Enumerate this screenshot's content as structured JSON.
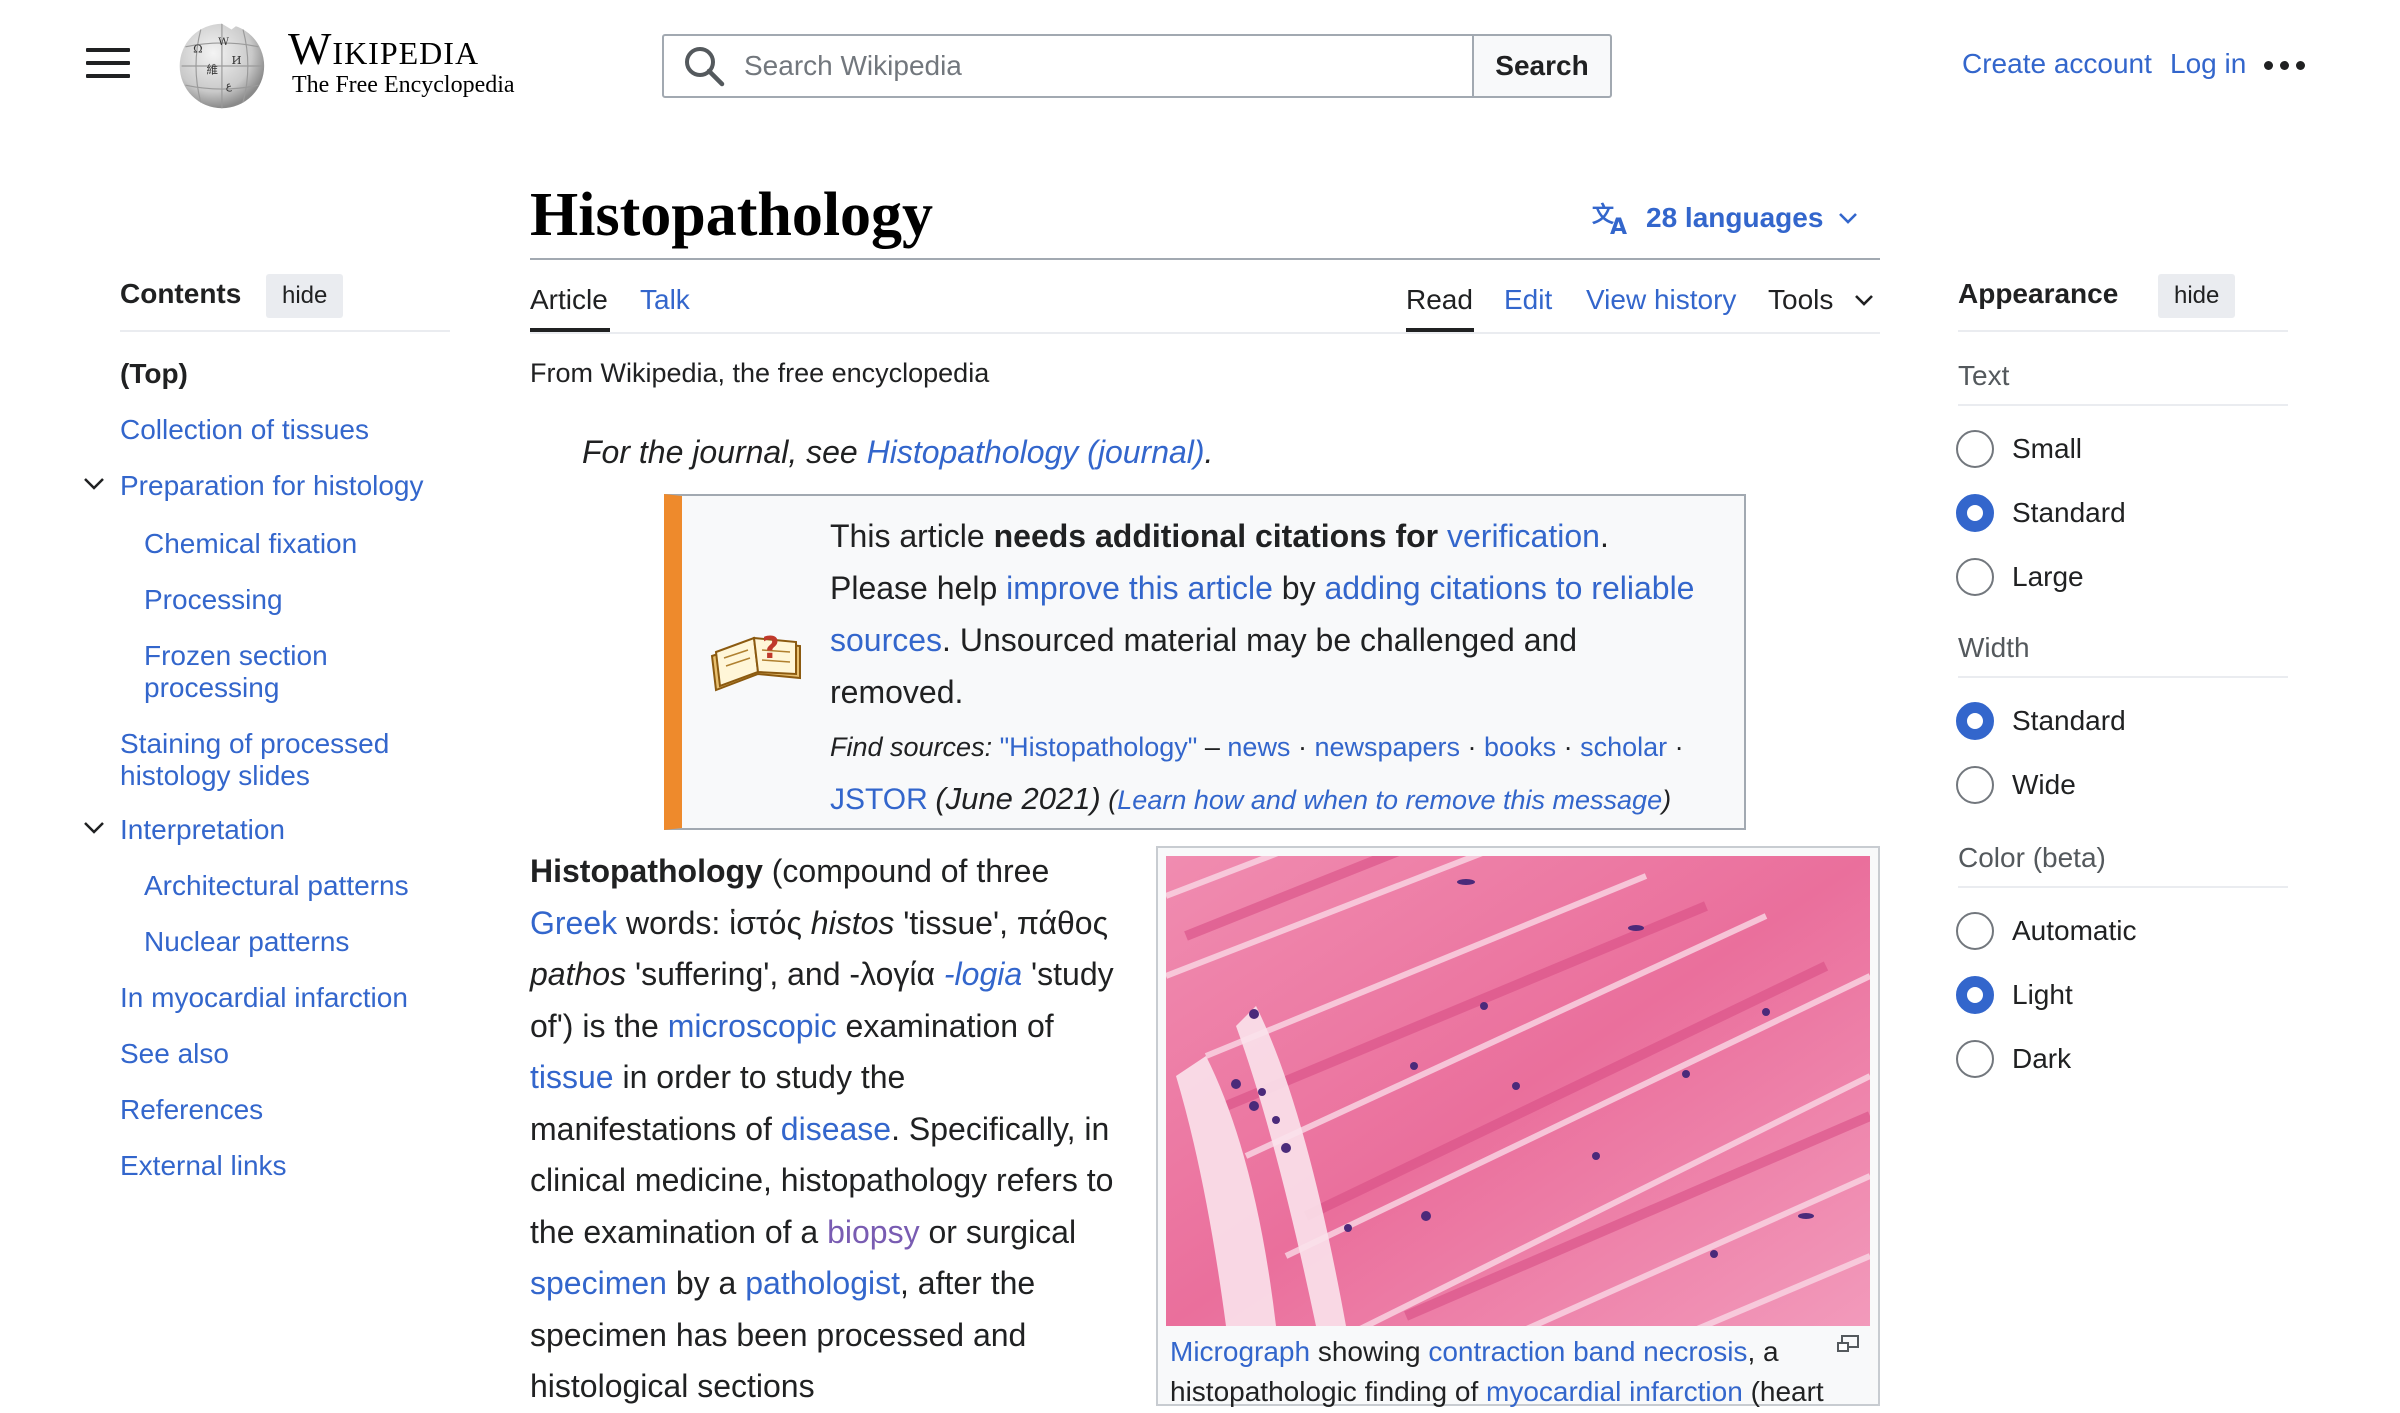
{
  "header": {
    "wordmark": "Wikipedia",
    "tagline": "The Free Encyclopedia",
    "search_placeholder": "Search Wikipedia",
    "search_button": "Search",
    "create_account": "Create account",
    "log_in": "Log in"
  },
  "toc": {
    "title": "Contents",
    "hide": "hide",
    "items": [
      {
        "label": "(Top)"
      },
      {
        "label": "Collection of tissues"
      },
      {
        "label": "Preparation for histology"
      },
      {
        "label": "Chemical fixation"
      },
      {
        "label": "Processing"
      },
      {
        "label": "Frozen section processing"
      },
      {
        "label": "Staining of processed histology slides"
      },
      {
        "label": "Interpretation"
      },
      {
        "label": "Architectural patterns"
      },
      {
        "label": "Nuclear patterns"
      },
      {
        "label": "In myocardial infarction"
      },
      {
        "label": "See also"
      },
      {
        "label": "References"
      },
      {
        "label": "External links"
      }
    ]
  },
  "article": {
    "title": "Histopathology",
    "languages": "28 languages",
    "tabs": {
      "article": "Article",
      "talk": "Talk",
      "read": "Read",
      "edit": "Edit",
      "view_history": "View history",
      "tools": "Tools"
    },
    "from": "From Wikipedia, the free encyclopedia",
    "hatnote_prefix": "For the journal, see",
    "hatnote_link": "Histopathology (journal)",
    "ambox": {
      "t1": "This article",
      "t1_bold": "needs additional citations for",
      "t1_link": "verification",
      "t2": "Please help",
      "t2_link1": "improve this article",
      "t2_mid": "by",
      "t2_link2": "adding citations to reliable sources",
      "t2_end": ". Unsourced material may be challenged and removed.",
      "find_sources": "Find sources:",
      "fs_query": "\"Histopathology\"",
      "fs_news": "news",
      "fs_newspapers": "newspapers",
      "fs_books": "books",
      "fs_scholar": "scholar",
      "fs_jstor": "JSTOR",
      "date": "(June 2021)",
      "learn": "Learn how and when to remove this message"
    },
    "body": {
      "b_term": "Histopathology",
      "p1": "(compound of three",
      "greek": "Greek",
      "p2": "words: ἱστός",
      "histos": "histos",
      "p3": "'tissue', πάθος",
      "pathos": "pathos",
      "p4": "'suffering', and -λογία",
      "logia": "-logia",
      "p5": "'study of') is the",
      "microscopic": "microscopic",
      "p6": "examination of",
      "tissue": "tissue",
      "p7": "in order to study the manifestations of",
      "disease": "disease",
      "p8": ". Specifically, in clinical medicine, histopathology refers to the examination of a",
      "biopsy": "biopsy",
      "p9": "or surgical",
      "specimen": "specimen",
      "p10": "by a",
      "pathologist": "pathologist",
      "p11": ", after the specimen has been processed and histological sections"
    },
    "caption": {
      "micrograph": "Micrograph",
      "c1": "showing",
      "cbn": "contraction band necrosis",
      "c2": ", a histopathologic finding of",
      "mi": "myocardial infarction",
      "c3": "(heart"
    }
  },
  "appearance": {
    "title": "Appearance",
    "hide": "hide",
    "text_label": "Text",
    "text_options": [
      {
        "label": "Small",
        "selected": false
      },
      {
        "label": "Standard",
        "selected": true
      },
      {
        "label": "Large",
        "selected": false
      }
    ],
    "width_label": "Width",
    "width_options": [
      {
        "label": "Standard",
        "selected": true
      },
      {
        "label": "Wide",
        "selected": false
      }
    ],
    "color_label": "Color (beta)",
    "color_options": [
      {
        "label": "Automatic",
        "selected": false
      },
      {
        "label": "Light",
        "selected": true
      },
      {
        "label": "Dark",
        "selected": false
      }
    ]
  },
  "colors": {
    "link": "#3366cc",
    "visited_link": "#795cb2",
    "ambox_accent": "#ee8a2c",
    "radio_selected": "#3366cc"
  }
}
